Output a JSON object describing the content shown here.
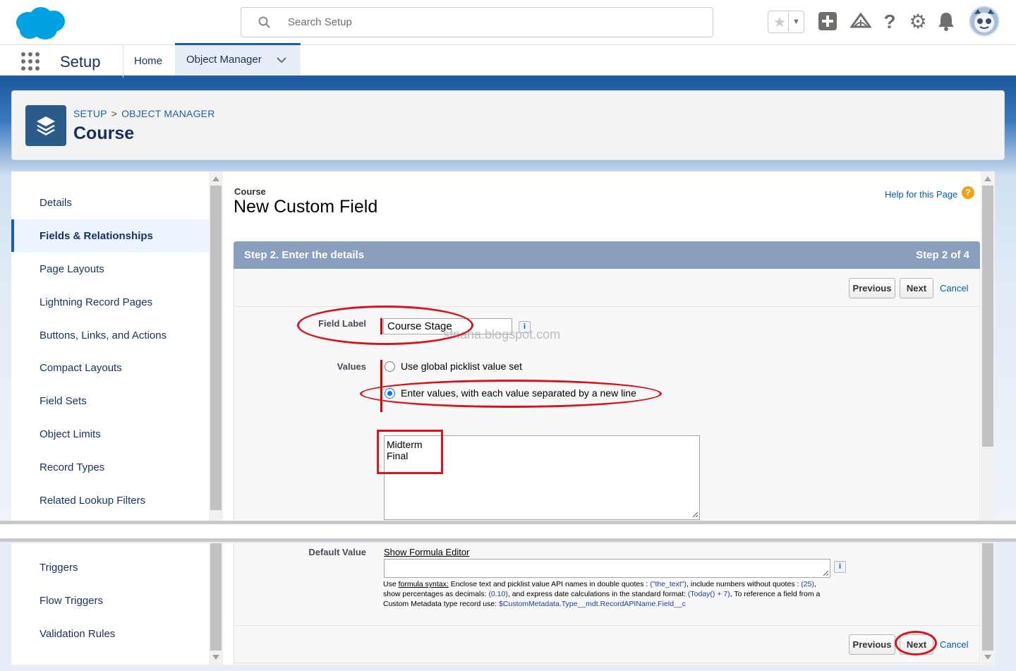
{
  "topbar": {
    "search_placeholder": "Search Setup",
    "icons": [
      "star-icon",
      "chevron-down-icon",
      "add-icon",
      "trailhead-icon",
      "help-icon",
      "gear-icon",
      "bell-icon",
      "avatar"
    ],
    "help_glyph": "?"
  },
  "nav": {
    "app_title": "Setup",
    "tabs": [
      {
        "label": "Home"
      },
      {
        "label": "Object Manager"
      }
    ]
  },
  "header": {
    "breadcrumb": [
      "SETUP",
      "OBJECT MANAGER"
    ],
    "breadcrumb_sep": ">",
    "title": "Course"
  },
  "sidebar": {
    "items": [
      {
        "label": "Details"
      },
      {
        "label": "Fields & Relationships",
        "active": true
      },
      {
        "label": "Page Layouts"
      },
      {
        "label": "Lightning Record Pages"
      },
      {
        "label": "Buttons, Links, and Actions"
      },
      {
        "label": "Compact Layouts"
      },
      {
        "label": "Field Sets"
      },
      {
        "label": "Object Limits"
      },
      {
        "label": "Record Types"
      },
      {
        "label": "Related Lookup Filters"
      },
      {
        "label": "Triggers"
      },
      {
        "label": "Flow Triggers"
      },
      {
        "label": "Validation Rules"
      }
    ]
  },
  "page": {
    "object_name": "Course",
    "title": "New Custom Field",
    "help_link": "Help for this Page",
    "step_title": "Step 2. Enter the details",
    "step_count": "Step 2 of 4",
    "buttons": {
      "previous": "Previous",
      "next": "Next",
      "cancel": "Cancel"
    },
    "form": {
      "field_label_label": "Field Label",
      "field_label_value": "Course Stage",
      "values_label": "Values",
      "radio_global": "Use global picklist value set",
      "radio_enter": "Enter values, with each value separated by a new line",
      "selected_radio": "enter",
      "picklist_values": "Midterm\nFinal",
      "default_value_label": "Default Value",
      "show_formula_editor": "Show Formula Editor",
      "info_glyph": "i",
      "help_text": {
        "use": "Use ",
        "formula_syntax": "formula syntax:",
        "p1": " Enclose text and picklist value API names in double quotes : ",
        "ex1": "(\"the_text\")",
        "p2": ", include numbers without quotes : ",
        "ex2": "(25)",
        "p3": ", show percentages as decimals: ",
        "ex3": "(0.10)",
        "p4": ", and express date calculations in the standard format: ",
        "ex4": "(Today() + 7)",
        "p5": ", To reference a field from a Custom Metadata type record use: ",
        "ex5": "$CustomMetadata.Type__mdt.RecordAPIName.Field__c"
      }
    },
    "watermark": "sfnaha.blogspot.com"
  },
  "colors": {
    "brand": "#1f5ea3",
    "step_bar": "#8a9ebe",
    "annotation": "#d5161e",
    "link": "#015ba7"
  }
}
